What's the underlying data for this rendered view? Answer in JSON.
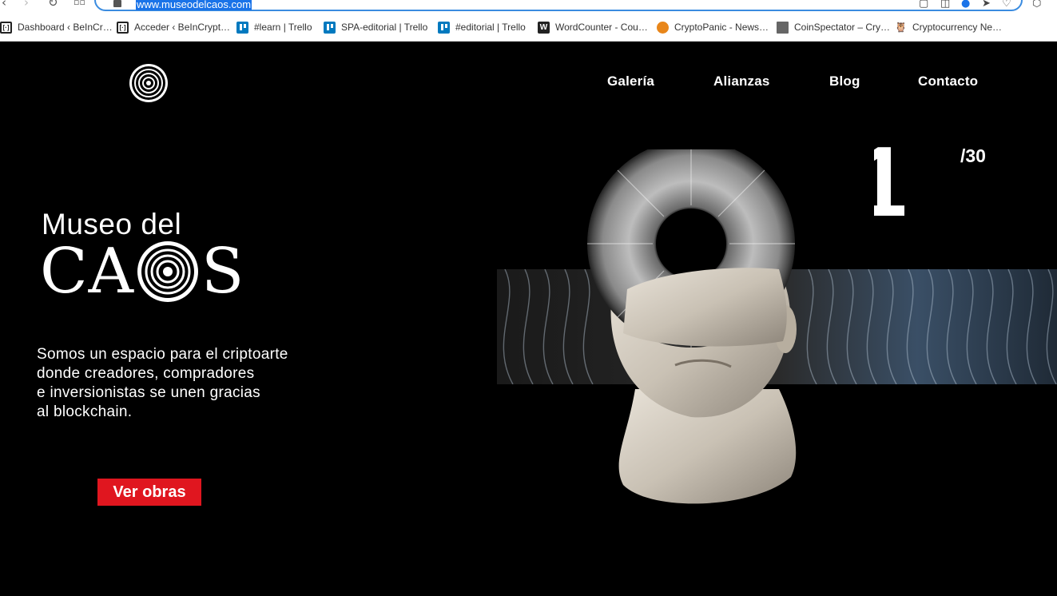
{
  "browser": {
    "url": "www.museodelcaos.com",
    "bookmarks": [
      {
        "label": "Dashboard ‹ BeInCr…",
        "icon": "beincrypto-icon"
      },
      {
        "label": "Acceder ‹ BeInCrypt…",
        "icon": "beincrypto-icon"
      },
      {
        "label": "#learn | Trello",
        "icon": "trello-icon"
      },
      {
        "label": "SPA-editorial | Trello",
        "icon": "trello-icon"
      },
      {
        "label": "#editorial | Trello",
        "icon": "trello-icon"
      },
      {
        "label": "WordCounter - Cou…",
        "icon": "wordcounter-icon"
      },
      {
        "label": "CryptoPanic - News…",
        "icon": "cryptopanic-icon"
      },
      {
        "label": "CoinSpectator – Cry…",
        "icon": "document-icon"
      },
      {
        "label": "Cryptocurrency Ne…",
        "icon": "owl-icon"
      }
    ]
  },
  "nav": {
    "items": [
      "Galería",
      "Alianzas",
      "Blog",
      "Contacto"
    ]
  },
  "hero": {
    "brand_line1": "Museo del",
    "brand_line2_a": "CA",
    "brand_line2_b": "S",
    "tagline": [
      "Somos un espacio para el criptoarte",
      "donde creadores, compradores",
      "e inversionistas se unen gracias",
      "al blockchain."
    ],
    "cta_label": "Ver obras",
    "slide_current": "01",
    "slide_total": "/30"
  },
  "colors": {
    "background": "#000000",
    "text": "#ffffff",
    "cta": "#e0161f",
    "url_highlight": "#1a73e8"
  }
}
